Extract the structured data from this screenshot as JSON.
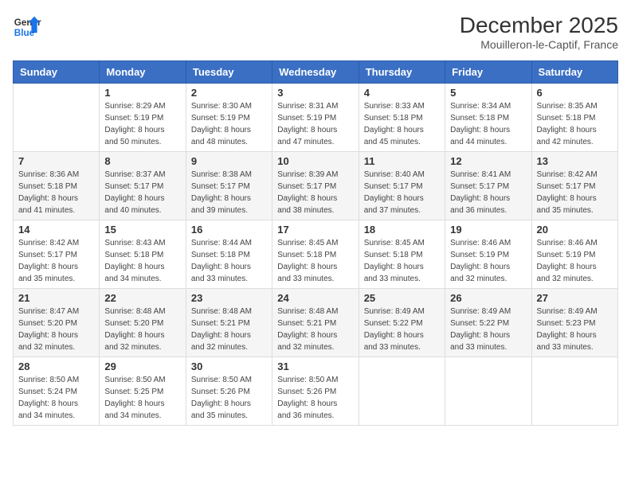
{
  "header": {
    "logo_line1": "General",
    "logo_line2": "Blue",
    "month": "December 2025",
    "location": "Mouilleron-le-Captif, France"
  },
  "weekdays": [
    "Sunday",
    "Monday",
    "Tuesday",
    "Wednesday",
    "Thursday",
    "Friday",
    "Saturday"
  ],
  "weeks": [
    [
      {
        "day": "",
        "info": ""
      },
      {
        "day": "1",
        "info": "Sunrise: 8:29 AM\nSunset: 5:19 PM\nDaylight: 8 hours\nand 50 minutes."
      },
      {
        "day": "2",
        "info": "Sunrise: 8:30 AM\nSunset: 5:19 PM\nDaylight: 8 hours\nand 48 minutes."
      },
      {
        "day": "3",
        "info": "Sunrise: 8:31 AM\nSunset: 5:19 PM\nDaylight: 8 hours\nand 47 minutes."
      },
      {
        "day": "4",
        "info": "Sunrise: 8:33 AM\nSunset: 5:18 PM\nDaylight: 8 hours\nand 45 minutes."
      },
      {
        "day": "5",
        "info": "Sunrise: 8:34 AM\nSunset: 5:18 PM\nDaylight: 8 hours\nand 44 minutes."
      },
      {
        "day": "6",
        "info": "Sunrise: 8:35 AM\nSunset: 5:18 PM\nDaylight: 8 hours\nand 42 minutes."
      }
    ],
    [
      {
        "day": "7",
        "info": "Sunrise: 8:36 AM\nSunset: 5:18 PM\nDaylight: 8 hours\nand 41 minutes."
      },
      {
        "day": "8",
        "info": "Sunrise: 8:37 AM\nSunset: 5:17 PM\nDaylight: 8 hours\nand 40 minutes."
      },
      {
        "day": "9",
        "info": "Sunrise: 8:38 AM\nSunset: 5:17 PM\nDaylight: 8 hours\nand 39 minutes."
      },
      {
        "day": "10",
        "info": "Sunrise: 8:39 AM\nSunset: 5:17 PM\nDaylight: 8 hours\nand 38 minutes."
      },
      {
        "day": "11",
        "info": "Sunrise: 8:40 AM\nSunset: 5:17 PM\nDaylight: 8 hours\nand 37 minutes."
      },
      {
        "day": "12",
        "info": "Sunrise: 8:41 AM\nSunset: 5:17 PM\nDaylight: 8 hours\nand 36 minutes."
      },
      {
        "day": "13",
        "info": "Sunrise: 8:42 AM\nSunset: 5:17 PM\nDaylight: 8 hours\nand 35 minutes."
      }
    ],
    [
      {
        "day": "14",
        "info": "Sunrise: 8:42 AM\nSunset: 5:17 PM\nDaylight: 8 hours\nand 35 minutes."
      },
      {
        "day": "15",
        "info": "Sunrise: 8:43 AM\nSunset: 5:18 PM\nDaylight: 8 hours\nand 34 minutes."
      },
      {
        "day": "16",
        "info": "Sunrise: 8:44 AM\nSunset: 5:18 PM\nDaylight: 8 hours\nand 33 minutes."
      },
      {
        "day": "17",
        "info": "Sunrise: 8:45 AM\nSunset: 5:18 PM\nDaylight: 8 hours\nand 33 minutes."
      },
      {
        "day": "18",
        "info": "Sunrise: 8:45 AM\nSunset: 5:18 PM\nDaylight: 8 hours\nand 33 minutes."
      },
      {
        "day": "19",
        "info": "Sunrise: 8:46 AM\nSunset: 5:19 PM\nDaylight: 8 hours\nand 32 minutes."
      },
      {
        "day": "20",
        "info": "Sunrise: 8:46 AM\nSunset: 5:19 PM\nDaylight: 8 hours\nand 32 minutes."
      }
    ],
    [
      {
        "day": "21",
        "info": "Sunrise: 8:47 AM\nSunset: 5:20 PM\nDaylight: 8 hours\nand 32 minutes."
      },
      {
        "day": "22",
        "info": "Sunrise: 8:48 AM\nSunset: 5:20 PM\nDaylight: 8 hours\nand 32 minutes."
      },
      {
        "day": "23",
        "info": "Sunrise: 8:48 AM\nSunset: 5:21 PM\nDaylight: 8 hours\nand 32 minutes."
      },
      {
        "day": "24",
        "info": "Sunrise: 8:48 AM\nSunset: 5:21 PM\nDaylight: 8 hours\nand 32 minutes."
      },
      {
        "day": "25",
        "info": "Sunrise: 8:49 AM\nSunset: 5:22 PM\nDaylight: 8 hours\nand 33 minutes."
      },
      {
        "day": "26",
        "info": "Sunrise: 8:49 AM\nSunset: 5:22 PM\nDaylight: 8 hours\nand 33 minutes."
      },
      {
        "day": "27",
        "info": "Sunrise: 8:49 AM\nSunset: 5:23 PM\nDaylight: 8 hours\nand 33 minutes."
      }
    ],
    [
      {
        "day": "28",
        "info": "Sunrise: 8:50 AM\nSunset: 5:24 PM\nDaylight: 8 hours\nand 34 minutes."
      },
      {
        "day": "29",
        "info": "Sunrise: 8:50 AM\nSunset: 5:25 PM\nDaylight: 8 hours\nand 34 minutes."
      },
      {
        "day": "30",
        "info": "Sunrise: 8:50 AM\nSunset: 5:26 PM\nDaylight: 8 hours\nand 35 minutes."
      },
      {
        "day": "31",
        "info": "Sunrise: 8:50 AM\nSunset: 5:26 PM\nDaylight: 8 hours\nand 36 minutes."
      },
      {
        "day": "",
        "info": ""
      },
      {
        "day": "",
        "info": ""
      },
      {
        "day": "",
        "info": ""
      }
    ]
  ]
}
